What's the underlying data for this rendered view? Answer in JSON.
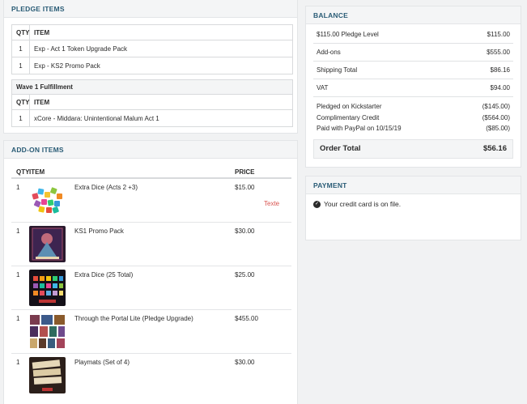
{
  "pledge": {
    "title": "PLEDGE ITEMS",
    "headers": {
      "qty": "QTY",
      "item": "ITEM"
    },
    "items": [
      {
        "qty": "1",
        "item": "Exp - Act 1 Token Upgrade Pack"
      },
      {
        "qty": "1",
        "item": "Exp - KS2 Promo Pack"
      }
    ],
    "wave": {
      "title": "Wave 1 Fulfillment",
      "headers": {
        "qty": "QTY",
        "item": "ITEM"
      },
      "items": [
        {
          "qty": "1",
          "item": "xCore - Middara: Unintentional Malum Act 1"
        }
      ]
    }
  },
  "addons": {
    "title": "ADD-ON ITEMS",
    "headers": {
      "qty": "QTY",
      "item": "ITEM",
      "price": "PRICE"
    },
    "items": [
      {
        "qty": "1",
        "name": "Extra Dice (Acts 2 +3)",
        "price": "$15.00",
        "image": "dice-image"
      },
      {
        "qty": "1",
        "name": "KS1 Promo Pack",
        "price": "$30.00",
        "image": "promo-pack-image"
      },
      {
        "qty": "1",
        "name": "Extra Dice (25 Total)",
        "price": "$25.00",
        "image": "dice-box-image"
      },
      {
        "qty": "1",
        "name": "Through the Portal Lite (Pledge Upgrade)",
        "price": "$455.00",
        "image": "card-collection-image"
      },
      {
        "qty": "1",
        "name": "Playmats (Set of 4)",
        "price": "$30.00",
        "image": "playmats-image"
      }
    ],
    "note": "Texte"
  },
  "balance": {
    "title": "BALANCE",
    "rows": [
      {
        "label": "$115.00 Pledge Level",
        "value": "$115.00"
      },
      {
        "label": "Add-ons",
        "value": "$555.00"
      },
      {
        "label": "Shipping Total",
        "value": "$86.16"
      },
      {
        "label": "VAT",
        "value": "$94.00"
      }
    ],
    "payments": [
      {
        "label": "Pledged on Kickstarter",
        "value": "($145.00)"
      },
      {
        "label": "Complimentary Credit",
        "value": "($564.00)"
      },
      {
        "label": "Paid with PayPal on 10/15/19",
        "value": "($85.00)"
      }
    ],
    "total_label": "Order Total",
    "total_value": "$56.16"
  },
  "payment": {
    "title": "PAYMENT",
    "message": "Your credit card is on file.",
    "icon": "check-circle-icon"
  },
  "colors": {
    "heading": "#2a5c76",
    "note": "#d9534f",
    "panel_bg": "#ffffff",
    "page_bg": "#f1f2f3"
  }
}
